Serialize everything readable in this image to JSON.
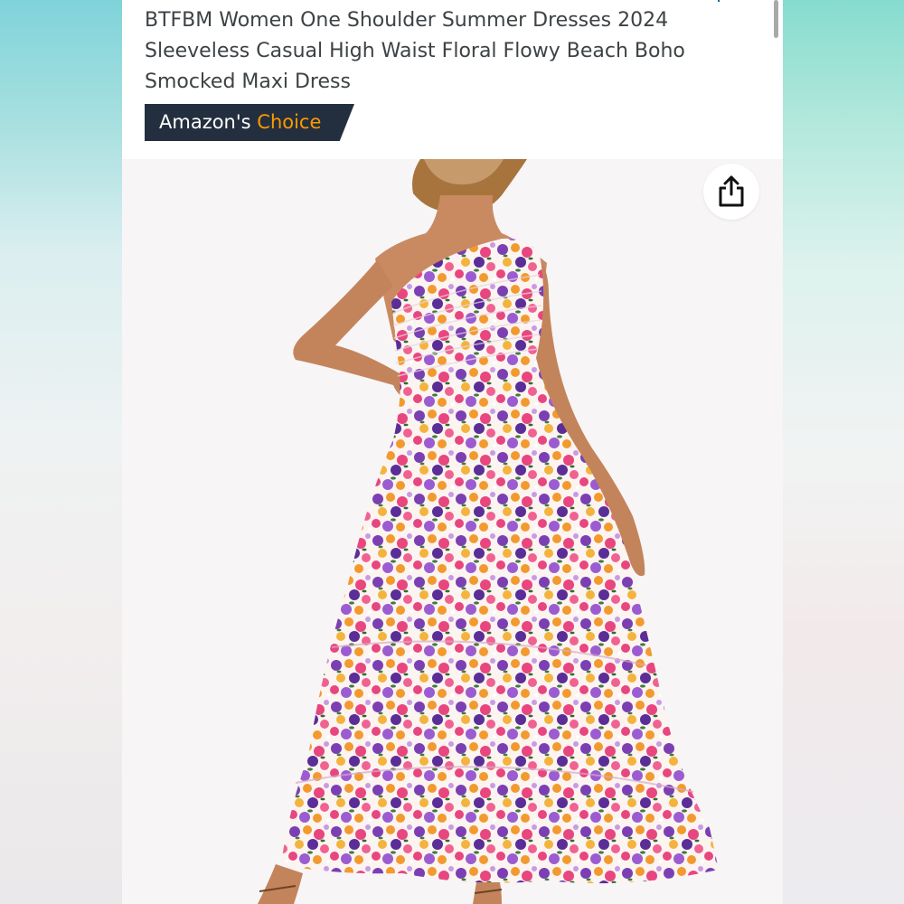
{
  "product": {
    "title": "BTFBM Women One Shoulder Summer Dresses 2024 Sleeveless Casual High Waist Floral Flowy Beach Boho Smocked Maxi Dress",
    "badge_prefix": "Amazon's",
    "badge_accent": "Choice"
  },
  "image": {
    "icon": "share-icon"
  },
  "colors": {
    "badge_bg": "#232f3e",
    "badge_accent": "#ff9900",
    "title_text": "#3d4245"
  }
}
